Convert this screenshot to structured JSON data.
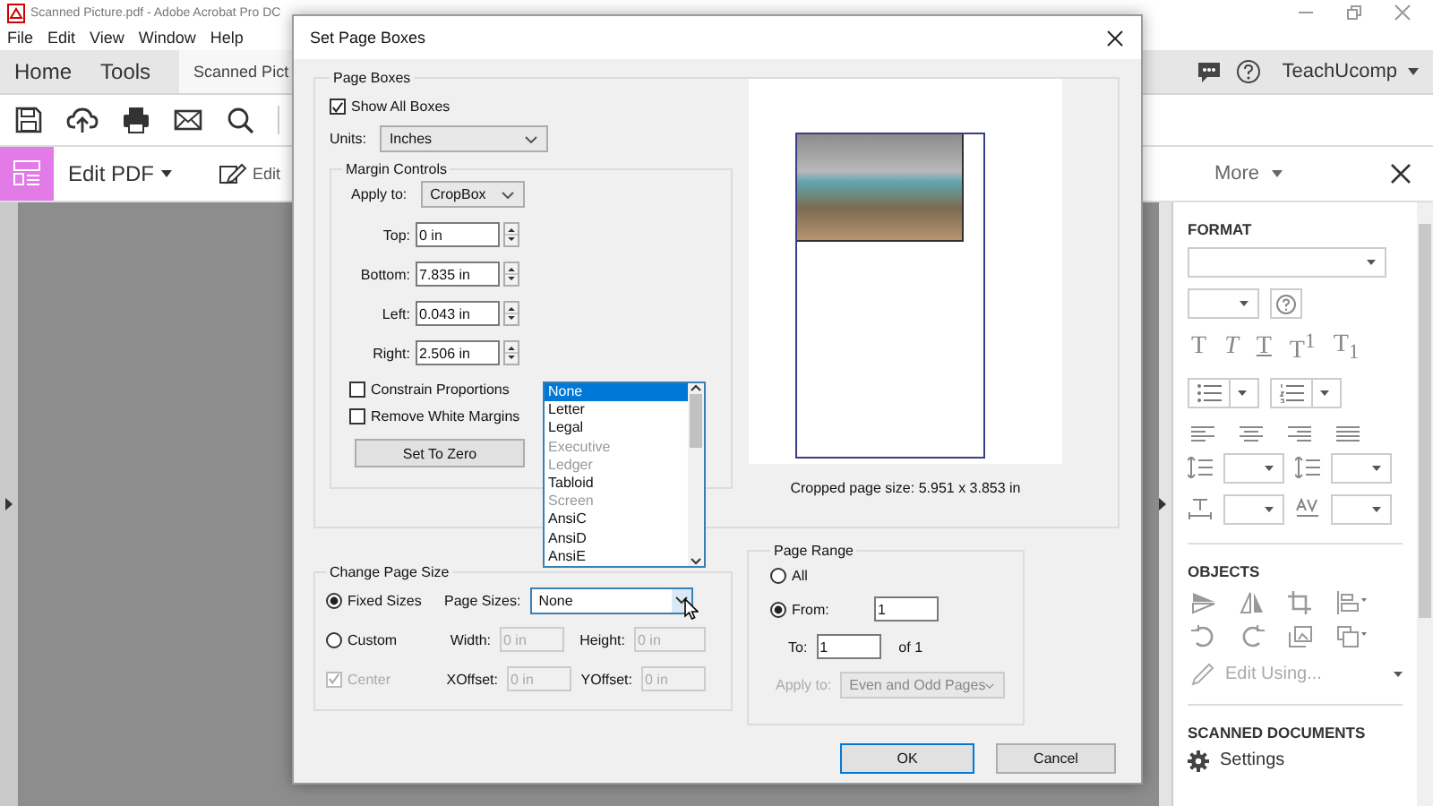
{
  "window": {
    "title": "Scanned Picture.pdf - Adobe Acrobat Pro DC"
  },
  "menu": [
    "File",
    "Edit",
    "View",
    "Window",
    "Help"
  ],
  "tabs": [
    {
      "label": "Home",
      "selected": false
    },
    {
      "label": "Tools",
      "selected": false
    },
    {
      "label": "Scanned Pict",
      "selected": true
    }
  ],
  "account": "TeachUcomp",
  "edit_bar": {
    "title": "Edit PDF",
    "edit": "Edit",
    "more": "More"
  },
  "format_panel": {
    "format_heading": "FORMAT",
    "text_styles": [
      {
        "glyph": "T",
        "kind": "plain"
      },
      {
        "glyph": "T",
        "kind": "italic"
      },
      {
        "glyph": "T",
        "kind": "underline"
      },
      {
        "glyph": "T$^{1}$",
        "kind": "plain"
      },
      {
        "glyph": "T$_{1}$",
        "kind": "plain"
      }
    ],
    "objects_heading": "OBJECTS",
    "edit_using": "Edit Using...",
    "scanned_heading": "SCANNED DOCUMENTS",
    "settings": "Settings"
  },
  "dialog": {
    "title": "Set Page Boxes",
    "page_boxes": {
      "legend": "Page Boxes",
      "show_all_boxes": {
        "label": "Show All Boxes",
        "checked": true
      },
      "units_label": "Units:",
      "units_value": "Inches",
      "margin_controls": {
        "legend": "Margin Controls",
        "apply_to_label": "Apply to:",
        "apply_to_value": "CropBox",
        "margins": [
          {
            "label": "Top:",
            "value": "0 in"
          },
          {
            "label": "Bottom:",
            "value": "7.835 in"
          },
          {
            "label": "Left:",
            "value": "0.043 in"
          },
          {
            "label": "Right:",
            "value": "2.506 in"
          }
        ],
        "constrain": {
          "label": "Constrain Proportions",
          "checked": false
        },
        "remove_white": {
          "label": "Remove White Margins",
          "checked": false
        },
        "set_to_zero": "Set To Zero"
      },
      "preview_caption": "Cropped page size: 5.951 x 3.853 in"
    },
    "change_page_size": {
      "legend": "Change Page Size",
      "modes": [
        {
          "label": "Fixed Sizes",
          "selected": true
        },
        {
          "label": "Custom",
          "selected": false
        }
      ],
      "page_sizes_label": "Page Sizes:",
      "page_sizes_value": "None",
      "options": [
        {
          "label": "None",
          "selected": true,
          "disabled": false
        },
        {
          "label": "Letter",
          "selected": false,
          "disabled": false
        },
        {
          "label": "Legal",
          "selected": false,
          "disabled": false
        },
        {
          "label": "Executive",
          "selected": false,
          "disabled": true
        },
        {
          "label": "Ledger",
          "selected": false,
          "disabled": true
        },
        {
          "label": "Tabloid",
          "selected": false,
          "disabled": false
        },
        {
          "label": "Screen",
          "selected": false,
          "disabled": true
        },
        {
          "label": "AnsiC",
          "selected": false,
          "disabled": false
        },
        {
          "label": "AnsiD",
          "selected": false,
          "disabled": false
        },
        {
          "label": "AnsiE",
          "selected": false,
          "disabled": false
        }
      ],
      "fields_disabled": true,
      "width_label": "Width:",
      "width_value": "0 in",
      "height_label": "Height:",
      "height_value": "0 in",
      "center": {
        "label": "Center",
        "checked": true,
        "disabled": true
      },
      "xoffset_label": "XOffset:",
      "xoffset_value": "0 in",
      "yoffset_label": "YOffset:",
      "yoffset_value": "0 in"
    },
    "page_range": {
      "legend": "Page Range",
      "modes": [
        {
          "label": "All",
          "selected": false
        },
        {
          "label": "From:",
          "selected": true
        }
      ],
      "from_value": "1",
      "to_label": "To:",
      "to_value": "1",
      "of_label": "of 1",
      "apply_disabled": true,
      "apply_to_label": "Apply to:",
      "apply_to_value": "Even and Odd Pages"
    },
    "buttons": [
      {
        "label": "OK",
        "default": true
      },
      {
        "label": "Cancel",
        "default": false
      }
    ]
  }
}
